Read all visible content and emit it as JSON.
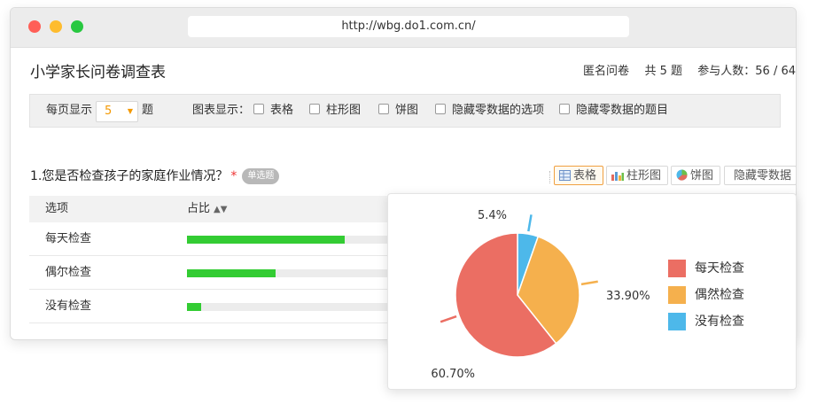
{
  "browser": {
    "url": "http://wbg.do1.com.cn/"
  },
  "header": {
    "title": "小学家长问卷调查表",
    "anonymous": "匿名问卷",
    "total_questions": "共 5 题",
    "participants": "参与人数：56 / 64"
  },
  "toolbar": {
    "per_page_label": "每页显示",
    "per_page_value": "5",
    "per_page_unit": "题",
    "chart_display_label": "图表显示：",
    "options": [
      "表格",
      "柱形图",
      "饼图",
      "隐藏零数据的选项",
      "隐藏零数据的题目"
    ]
  },
  "question": {
    "title": "1.您是否检查孩子的家庭作业情况？",
    "required_mark": "*",
    "type_badge": "单选题",
    "view_buttons": [
      "表格",
      "柱形图",
      "饼图",
      "隐藏零数据"
    ]
  },
  "table": {
    "headers": [
      "选项",
      "占比"
    ],
    "sort_icon": "sort-icon",
    "rows": [
      {
        "label": "每天检查",
        "ratio": 0.607
      },
      {
        "label": "偶尔检查",
        "ratio": 0.339
      },
      {
        "label": "没有检查",
        "ratio": 0.054
      }
    ]
  },
  "colors": {
    "bar": "#33cc33",
    "slice_daily": "#eb6e63",
    "slice_sometimes": "#f5b04d",
    "slice_never": "#4db8ea",
    "accent": "#f39800"
  },
  "chart_data": {
    "type": "pie",
    "categories": [
      "每天检查",
      "偶然检查",
      "没有检查"
    ],
    "values": [
      60.7,
      33.9,
      5.4
    ],
    "data_labels": [
      "60.70%",
      "33.90%",
      "5.4%"
    ],
    "legend_position": "right"
  }
}
